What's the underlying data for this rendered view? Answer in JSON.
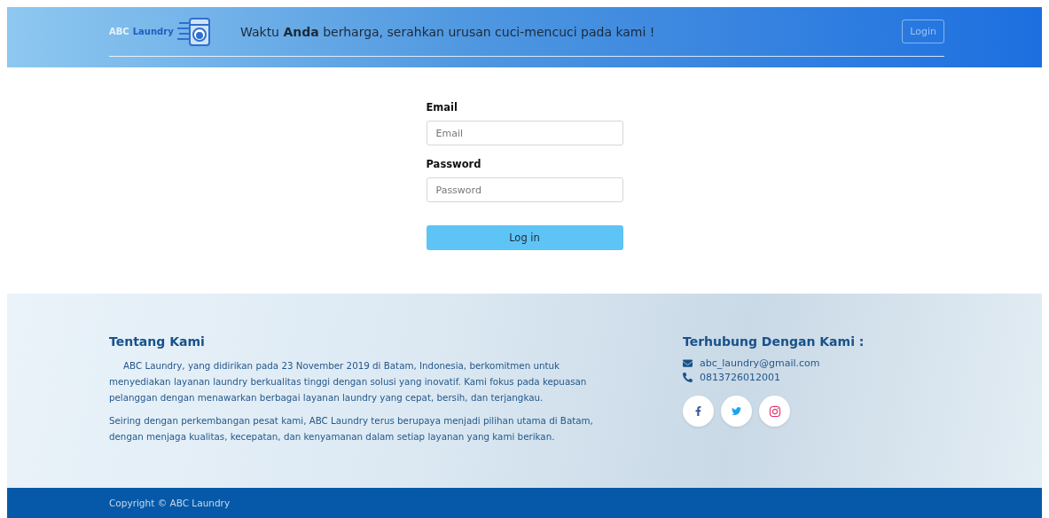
{
  "header": {
    "logo": {
      "word_1": "ABC",
      "word_2": "Laundry"
    },
    "tagline": "Waktu **Anda** berharga, serahkan urusan cuci-mencuci pada kami !",
    "login_button": "Login"
  },
  "login_form": {
    "fields": [
      {
        "label": "Email",
        "placeholder": "Email"
      },
      {
        "label": "Password",
        "placeholder": "Password"
      }
    ],
    "submit": "Log in"
  },
  "about": {
    "title": "Tentang Kami",
    "paragraphs": [
      "ABC Laundry, yang didirikan pada 23 November 2019 di Batam, Indonesia, berkomitmen untuk menyediakan layanan laundry berkualitas tinggi dengan solusi yang inovatif. Kami fokus pada kepuasan pelanggan dengan menawarkan berbagai layanan laundry yang cepat, bersih, dan terjangkau.",
      "Seiring dengan perkembangan pesat kami, ABC Laundry terus berupaya menjadi pilihan utama di Batam, dengan menjaga kualitas, kecepatan, dan kenyamanan dalam setiap layanan yang kami berikan."
    ]
  },
  "contact": {
    "title": "Terhubung Dengan Kami :",
    "items": [
      {
        "kind": "email",
        "text": "abc_laundry@gmail.com"
      },
      {
        "kind": "phone",
        "text": "0813726012001"
      }
    ],
    "social": [
      {
        "kind": "facebook",
        "color": "#3b5998"
      },
      {
        "kind": "twitter",
        "color": "#1da1f2"
      },
      {
        "kind": "instagram",
        "color": "#e1306c"
      }
    ]
  },
  "copyright": "Copyright © ABC Laundry"
}
